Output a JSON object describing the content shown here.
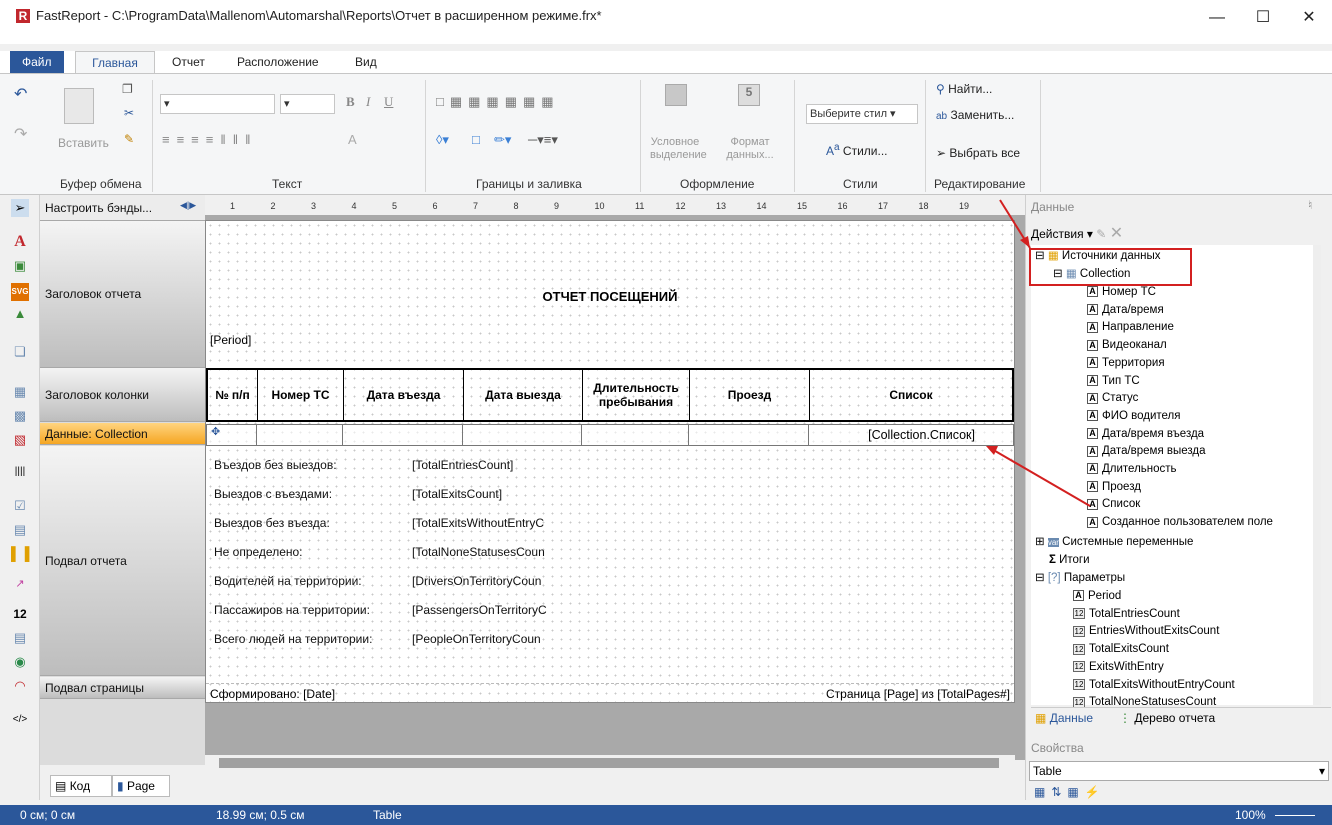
{
  "window": {
    "title": "FastReport - C:\\ProgramData\\Mallenom\\Automarshal\\Reports\\Отчет в расширенном режиме.frx*",
    "logo_letter": "R"
  },
  "tabs": [
    "Файл",
    "Главная",
    "Отчет",
    "Расположение",
    "Вид"
  ],
  "ribbon": {
    "groups": [
      "Буфер обмена",
      "Текст",
      "Границы и заливка",
      "Оформление",
      "Стили",
      "Редактирование"
    ],
    "paste": "Вставить",
    "cond": [
      "Условное",
      "выделение"
    ],
    "format": [
      "Формат",
      "данных..."
    ],
    "style_placeholder": "Выберите стил",
    "styles_btn": "Стили...",
    "find": "Найти...",
    "replace": "Заменить...",
    "select_all": "Выбрать все"
  },
  "designer": {
    "config_bands": "Настроить бэнды...",
    "bands": [
      "Заголовок отчета",
      "Заголовок колонки",
      "Данные: Collection",
      "Подвал отчета",
      "Подвал страницы"
    ],
    "ruler": [
      "1",
      "2",
      "3",
      "4",
      "5",
      "6",
      "7",
      "8",
      "9",
      "10",
      "11",
      "12",
      "13",
      "14",
      "15",
      "16",
      "17",
      "18",
      "19"
    ]
  },
  "report": {
    "title": "ОТЧЕТ ПОСЕЩЕНИЙ",
    "period": "[Period]",
    "columns": [
      "№ п/п",
      "Номер ТС",
      "Дата въезда",
      "Дата выезда",
      "Длительность пребывания",
      "Проезд",
      "Список"
    ],
    "data_cell": "[Collection.Список]",
    "summary": [
      {
        "label": "Въездов без выездов:",
        "value": "[TotalEntriesCount]"
      },
      {
        "label": "Выездов с въездами:",
        "value": "[TotalExitsCount]"
      },
      {
        "label": "Выездов без въезда:",
        "value": "[TotalExitsWithoutEntryC"
      },
      {
        "label": "Не определено:",
        "value": "[TotalNoneStatusesCoun"
      },
      {
        "label": "Водителей на территории:",
        "value": "[DriversOnTerritoryCoun"
      },
      {
        "label": "Пассажиров на территории:",
        "value": "[PassengersOnTerritoryC"
      },
      {
        "label": "Всего людей на территории:",
        "value": "[PeopleOnTerritoryCoun"
      }
    ],
    "footer_left": "Сформировано: [Date]",
    "footer_right": "Страница [Page] из [TotalPages#]"
  },
  "bottom_tabs": [
    "Код",
    "Page"
  ],
  "data_panel": {
    "title": "Данные",
    "actions": "Действия",
    "sources": "Источники данных",
    "collection": "Collection",
    "fields": [
      "Номер ТС",
      "Дата/время",
      "Направление",
      "Видеоканал",
      "Территория",
      "Тип ТС",
      "Статус",
      "ФИО водителя",
      "Дата/время въезда",
      "Дата/время выезда",
      "Длительность",
      "Проезд",
      "Список",
      "Созданное пользователем поле"
    ],
    "system_vars": "Системные переменные",
    "totals": "Итоги",
    "params": "Параметры",
    "param_items": [
      {
        "icon": "A",
        "name": "Period"
      },
      {
        "icon": "12",
        "name": "TotalEntriesCount"
      },
      {
        "icon": "12",
        "name": "EntriesWithoutExitsCount"
      },
      {
        "icon": "12",
        "name": "TotalExitsCount"
      },
      {
        "icon": "12",
        "name": "ExitsWithEntry"
      },
      {
        "icon": "12",
        "name": "TotalExitsWithoutEntryCount"
      },
      {
        "icon": "12",
        "name": "TotalNoneStatusesCount"
      }
    ],
    "tab_data": "Данные",
    "tab_tree": "Дерево отчета"
  },
  "props_panel": {
    "title": "Свойства",
    "selected": "Table"
  },
  "status": {
    "pos": "0 см; 0 см",
    "size": "18.99 см; 0.5 см",
    "obj": "Table",
    "zoom": "100%"
  }
}
